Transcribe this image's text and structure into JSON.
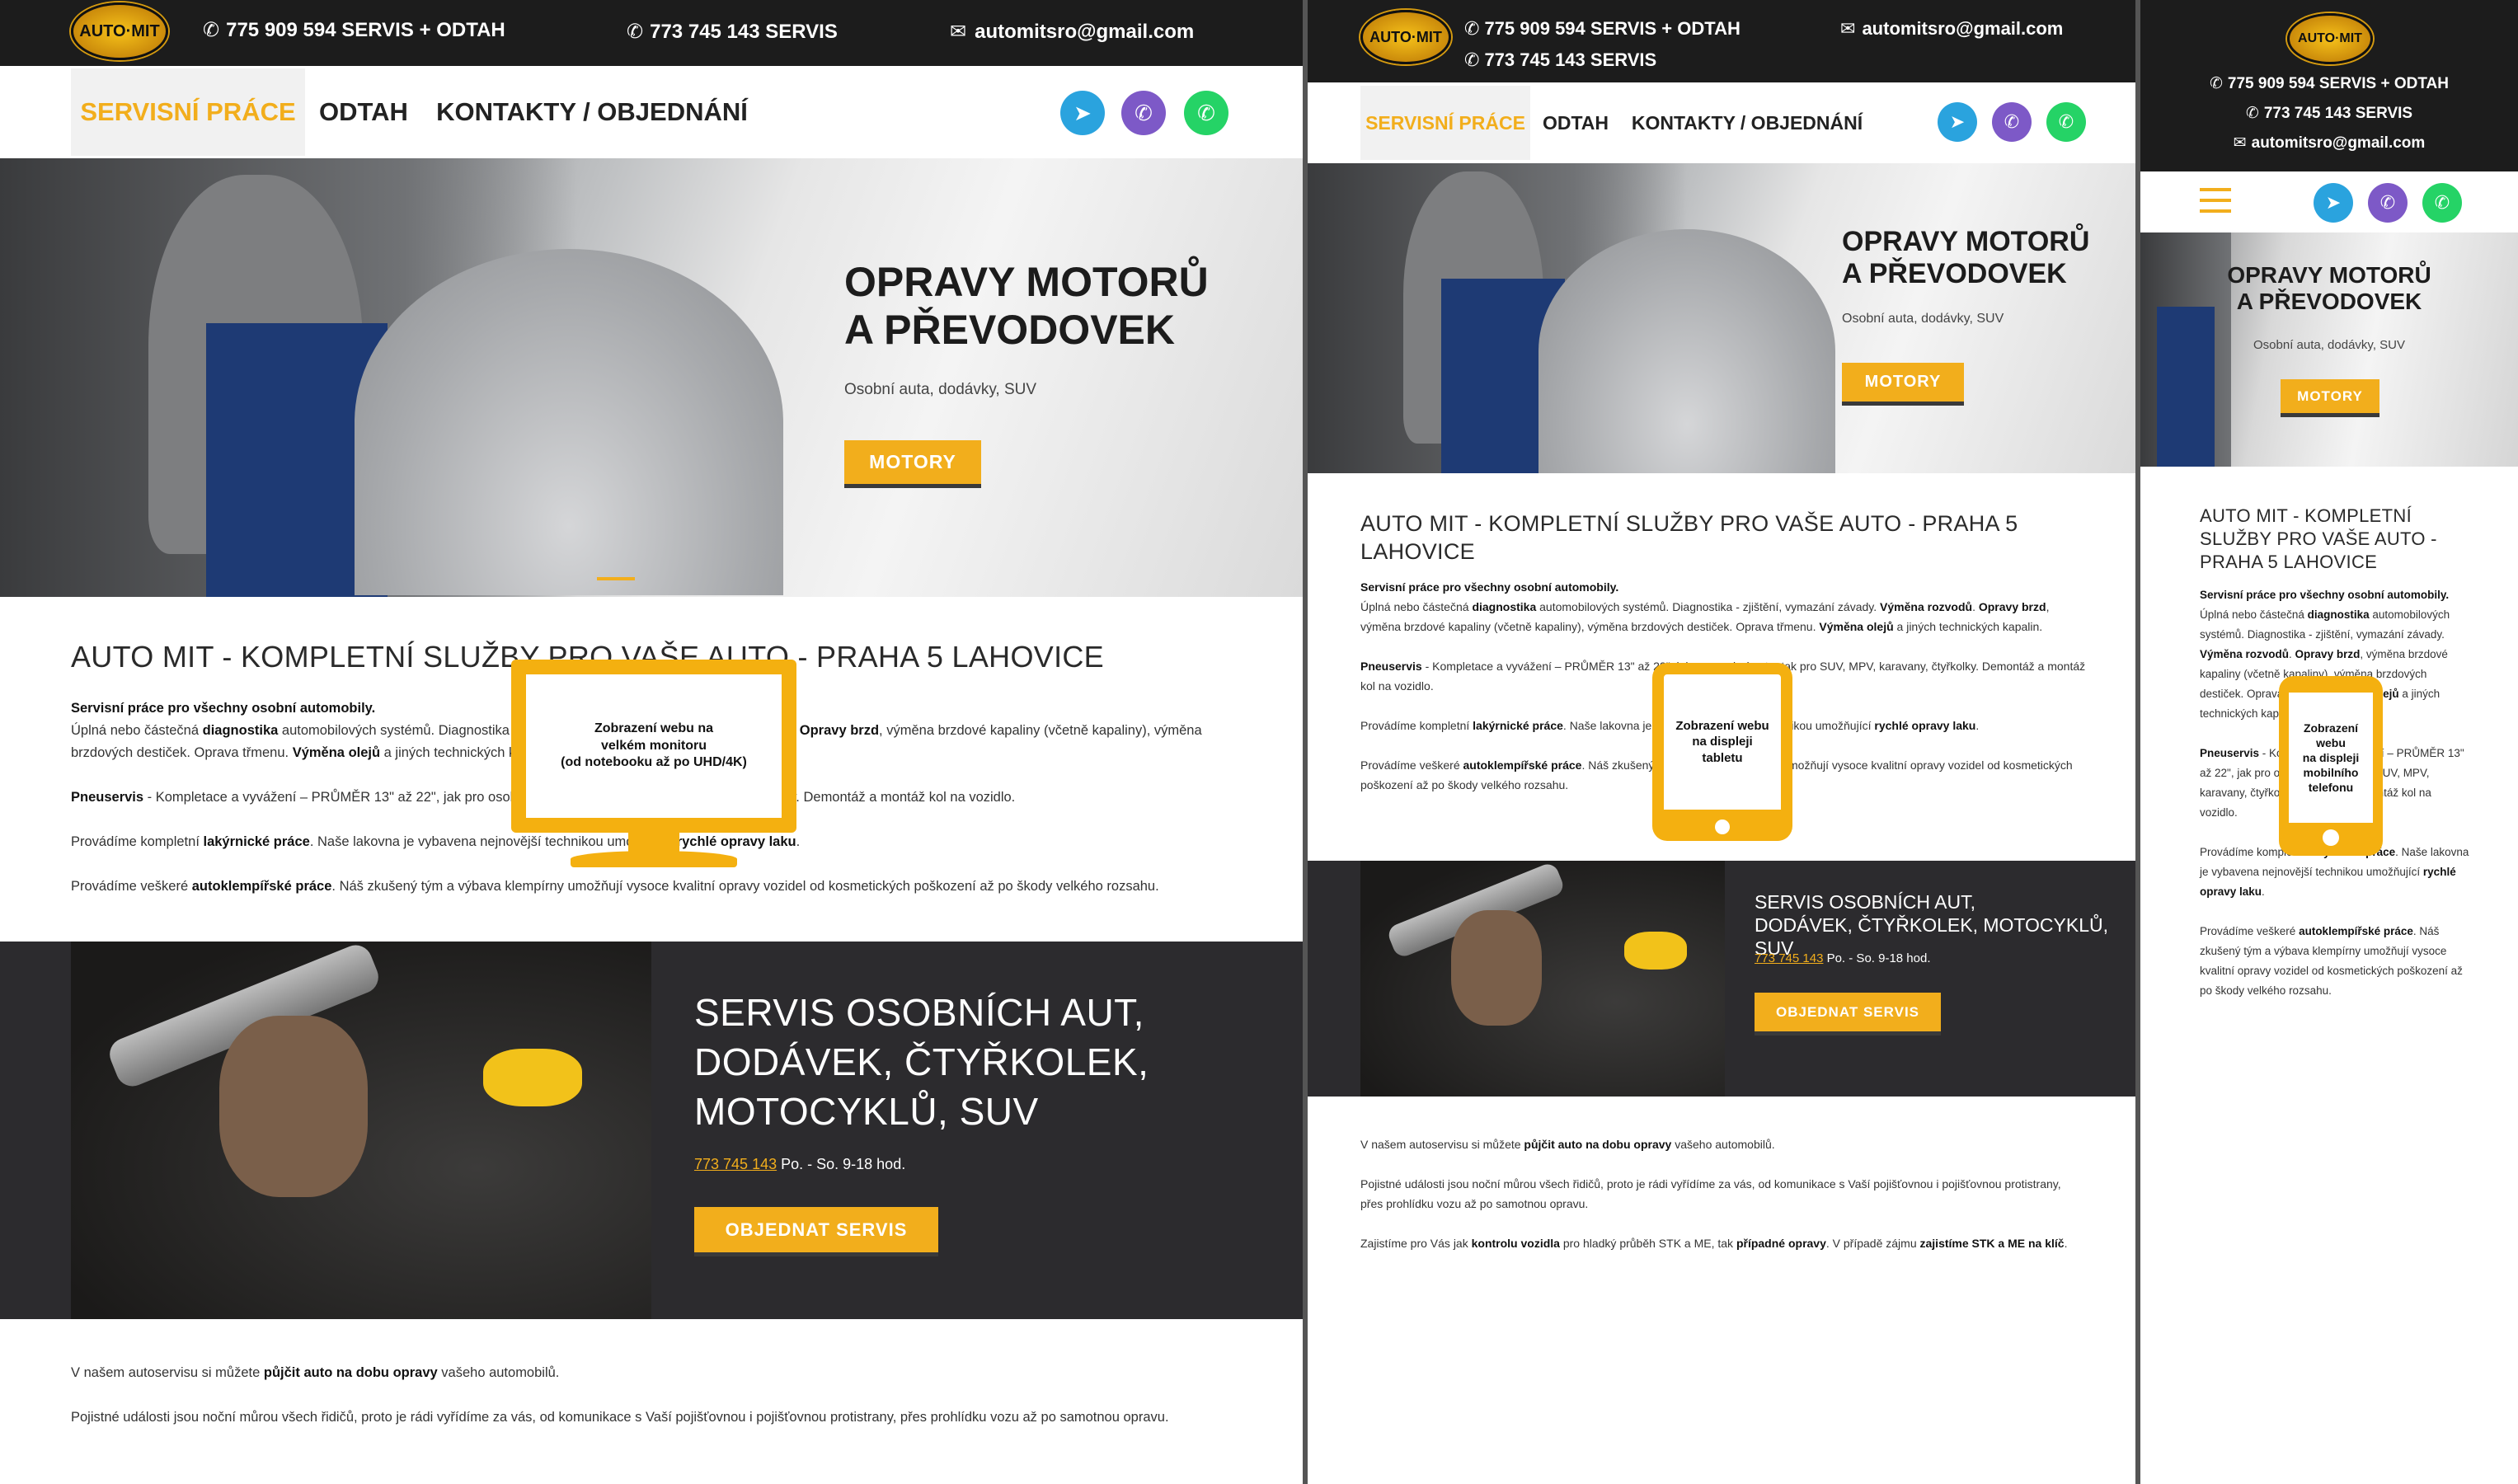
{
  "header": {
    "phone_primary": "775 909 594 SERVIS + ODTAH",
    "phone_secondary": "773 745 143 SERVIS",
    "email": "automitsro@gmail.com",
    "logo_text": "AUTO·MIT"
  },
  "nav": {
    "items": [
      "SERVISNÍ PRÁCE",
      "ODTAH",
      "KONTAKTY / OBJEDNÁNÍ"
    ],
    "active_index": 0
  },
  "social": {
    "telegram": "telegram-icon",
    "viber": "viber-icon",
    "whatsapp": "whatsapp-icon"
  },
  "hero": {
    "title_line1": "OPRAVY MOTORŮ",
    "title_line2": "A PŘEVODOVEK",
    "subtitle": "Osobní auta, dodávky, SUV",
    "button": "MOTORY"
  },
  "intro": {
    "heading": "AUTO MIT - KOMPLETNÍ SLUŽBY PRO VAŠE AUTO - PRAHA 5 LAHOVICE",
    "lead_bold": "Servisní práce pro všechny osobní automobily.",
    "p1_a": "Úplná nebo částečná ",
    "p1_b": "diagnostika",
    "p1_c": " automobilových systémů. Diagnostika - zjištění, vymazání závady. ",
    "p1_d": "Výměna rozvodů",
    "p1_e": ". ",
    "p1_f": "Opravy brzd",
    "p1_g": ", výměna brzdové kapaliny (včetně kapaliny), výměna brzdových destiček. Oprava třmenu. ",
    "p1_h": "Výměna olejů",
    "p1_i": " a jiných technických kapalin.",
    "p2_a": "Pneuservis",
    "p2_b": " - Kompletace a vyvážení – PRŮMĚR 13\" až 22\", jak pro osobní auta, tak pro SUV, MPV, karavany, čtyřkolky. Demontáž a montáž kol na vozidlo.",
    "p3_a": "Provádíme kompletní ",
    "p3_b": "lakýrnické práce",
    "p3_c": ". Naše lakovna je vybavena nejnovější technikou umožňující ",
    "p3_d": "rychlé opravy laku",
    "p3_e": ".",
    "p4_a": "Provádíme veškeré ",
    "p4_b": "autoklempířské práce",
    "p4_c": ". Náš zkušený tým a výbava klempírny umožňují vysoce kvalitní opravy vozidel od kosmetických poškození až po škody velkého rozsahu."
  },
  "service_band": {
    "title_line1": "SERVIS OSOBNÍCH AUT,",
    "title_line2": "DODÁVEK, ČTYŘKOLEK,",
    "title_line3": "MOTOCYKLŮ, SUV",
    "phone_link": "773 745 143",
    "hours": " Po. - So. 9-18 hod.",
    "button": "OBJEDNAT SERVIS"
  },
  "footer_text": {
    "p1_a": "V našem autoservisu si můžete ",
    "p1_b": "půjčit auto na dobu opravy",
    "p1_c": " vašeho automobilů.",
    "p2": "Pojistné události jsou noční můrou všech řidičů, proto je rádi vyřídíme za vás, od komunikace s Vaší pojišťovnou i pojišťovnou protistrany, přes prohlídku vozu až po samotnou opravu.",
    "p3_a": "Zajistíme pro Vás jak ",
    "p3_b": "kontrolu vozidla",
    "p3_c": " pro hladký průběh STK a ME, tak ",
    "p3_d": "případné opravy",
    "p3_e": ". V případě zájmu ",
    "p3_f": "zajistíme STK a ME na klíč",
    "p3_g": "."
  },
  "device_labels": {
    "monitor": [
      "Zobrazení webu na",
      "velkém monitoru",
      "(od notebooku až po UHD/4K)"
    ],
    "tablet": [
      "Zobrazení webu",
      "na displeji",
      "tabletu"
    ],
    "phone": [
      "Zobrazení",
      "webu",
      "na displeji",
      "mobilního",
      "telefonu"
    ]
  },
  "colors": {
    "accent": "#f2ae1c",
    "dark": "#1c1c1c",
    "band": "#2c2b2e"
  }
}
